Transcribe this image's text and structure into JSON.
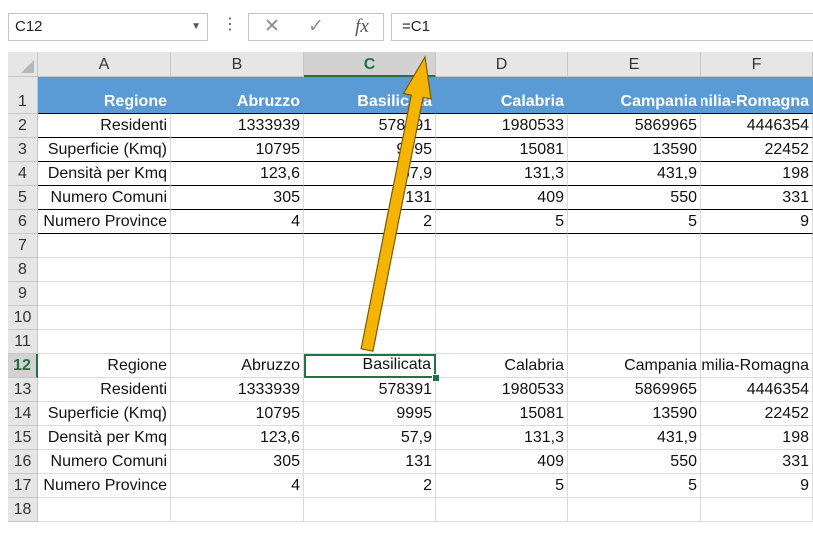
{
  "formula_bar": {
    "name_box": "C12",
    "cancel_glyph": "✕",
    "enter_glyph": "✓",
    "fx_label": "fx",
    "formula": "=C1"
  },
  "columns": [
    "A",
    "B",
    "C",
    "D",
    "E",
    "F"
  ],
  "selected_column": "C",
  "rows": [
    "1",
    "2",
    "3",
    "4",
    "5",
    "6",
    "7",
    "8",
    "9",
    "10",
    "11",
    "12",
    "13",
    "14",
    "15",
    "16",
    "17",
    "18"
  ],
  "selected_row": "12",
  "table_top": {
    "header": [
      "Regione",
      "Abruzzo",
      "Basilicata",
      "Calabria",
      "Campania",
      "Emilia-Romagna"
    ],
    "data": [
      [
        "Residenti",
        "1333939",
        "578391",
        "1980533",
        "5869965",
        "4446354"
      ],
      [
        "Superficie (Kmq)",
        "10795",
        "9995",
        "15081",
        "13590",
        "22452"
      ],
      [
        "Densità per Kmq",
        "123,6",
        "57,9",
        "131,3",
        "431,9",
        "198"
      ],
      [
        "Numero Comuni",
        "305",
        "131",
        "409",
        "550",
        "331"
      ],
      [
        "Numero Province",
        "4",
        "2",
        "5",
        "5",
        "9"
      ]
    ]
  },
  "table_bottom": {
    "header": [
      "Regione",
      "Abruzzo",
      "Basilicata",
      "Calabria",
      "Campania",
      "Emilia-Romagna"
    ],
    "data": [
      [
        "Residenti",
        "1333939",
        "578391",
        "1980533",
        "5869965",
        "4446354"
      ],
      [
        "Superficie (Kmq)",
        "10795",
        "9995",
        "15081",
        "13590",
        "22452"
      ],
      [
        "Densità per Kmq",
        "123,6",
        "57,9",
        "131,3",
        "431,9",
        "198"
      ],
      [
        "Numero Comuni",
        "305",
        "131",
        "409",
        "550",
        "331"
      ],
      [
        "Numero Province",
        "4",
        "2",
        "5",
        "5",
        "9"
      ]
    ]
  },
  "annotation": {
    "arrow_color": "#f5b400"
  }
}
